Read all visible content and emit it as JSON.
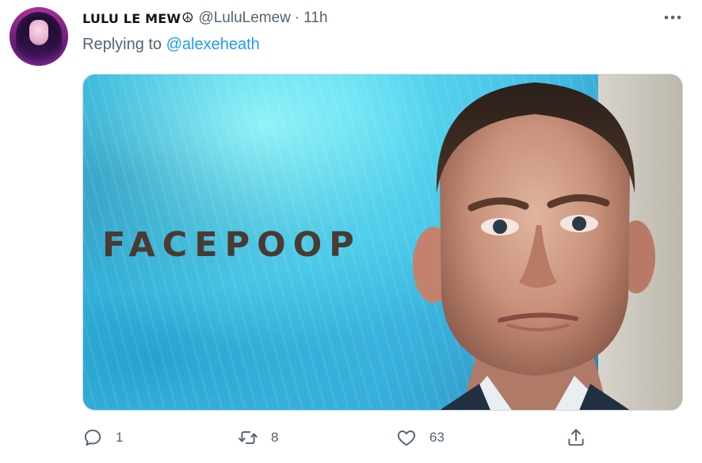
{
  "tweet": {
    "display_name": "LULU LE MEW",
    "name_emoji": "☮",
    "handle": "@LuluLemew",
    "separator": "·",
    "time": "11h",
    "reply_prefix": "Replying to",
    "reply_mention": "@alexeheath",
    "media": {
      "overlay_text": "FACEPOOP"
    },
    "actions": {
      "reply_count": "1",
      "retweet_count": "8",
      "like_count": "63"
    }
  },
  "icons": {
    "more": "more-icon",
    "reply": "reply-icon",
    "retweet": "retweet-icon",
    "like": "heart-icon",
    "share": "share-icon"
  },
  "colors": {
    "text_primary": "#0f1419",
    "text_secondary": "#536471",
    "link": "#1d9bf0",
    "overlay_text": "#4a3a32"
  }
}
